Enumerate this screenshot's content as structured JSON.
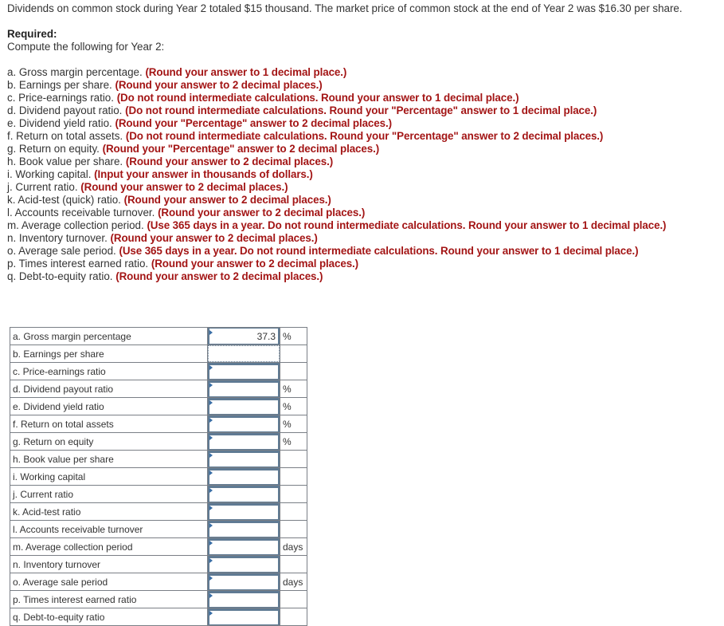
{
  "intro": "Dividends on common stock during Year 2 totaled $15 thousand. The market price of common stock at the end of Year 2 was $16.30 per share.",
  "required": {
    "heading": "Required:",
    "instruction": "Compute the following for Year 2:"
  },
  "questions": [
    {
      "text": "a. Gross margin percentage.",
      "note": "(Round your answer to 1 decimal place.)"
    },
    {
      "text": "b. Earnings per share.",
      "note": "(Round your answer to 2 decimal places.)"
    },
    {
      "text": "c. Price-earnings ratio.",
      "note": "(Do not round intermediate calculations. Round your answer to 1 decimal place.)"
    },
    {
      "text": "d. Dividend payout ratio.",
      "note": "(Do not round intermediate calculations. Round your \"Percentage\" answer to 1 decimal place.)"
    },
    {
      "text": "e. Dividend yield ratio.",
      "note": "(Round your \"Percentage\" answer to 2 decimal places.)"
    },
    {
      "text": "f. Return on total assets.",
      "note": "(Do not round intermediate calculations. Round your \"Percentage\" answer to 2 decimal places.)"
    },
    {
      "text": "g. Return on equity.",
      "note": "(Round your \"Percentage\" answer to 2 decimal places.)"
    },
    {
      "text": "h. Book value per share.",
      "note": "(Round your answer to 2 decimal places.)"
    },
    {
      "text": "i. Working capital.",
      "note": "(Input your answer in thousands of dollars.)"
    },
    {
      "text": "j. Current ratio.",
      "note": "(Round your answer to 2 decimal places.)"
    },
    {
      "text": "k. Acid-test (quick) ratio.",
      "note": "(Round your answer to 2 decimal places.)"
    },
    {
      "text": "l. Accounts receivable turnover.",
      "note": "(Round your answer to 2 decimal places.)"
    },
    {
      "text": "m. Average collection period.",
      "note": "(Use 365 days in a year. Do not round intermediate calculations. Round your answer to 1 decimal place.)"
    },
    {
      "text": "n. Inventory turnover.",
      "note": "(Round your answer to 2 decimal places.)"
    },
    {
      "text": "o. Average sale period.",
      "note": "(Use 365 days in a year. Do not round intermediate calculations. Round your answer to 1 decimal place.)"
    },
    {
      "text": "p. Times interest earned ratio.",
      "note": "(Round your answer to 2 decimal places.)"
    },
    {
      "text": "q. Debt-to-equity ratio.",
      "note": "(Round your answer to 2 decimal places.)"
    }
  ],
  "answer_table": {
    "rows": [
      {
        "label": "a. Gross margin percentage",
        "value": "37.3",
        "unit": "%"
      },
      {
        "label": "b. Earnings per share",
        "value": "",
        "unit": ""
      },
      {
        "label": "c. Price-earnings ratio",
        "value": "",
        "unit": ""
      },
      {
        "label": "d. Dividend payout ratio",
        "value": "",
        "unit": "%"
      },
      {
        "label": "e. Dividend yield ratio",
        "value": "",
        "unit": "%"
      },
      {
        "label": "f. Return on total assets",
        "value": "",
        "unit": "%"
      },
      {
        "label": "g. Return on equity",
        "value": "",
        "unit": "%"
      },
      {
        "label": "h. Book value per share",
        "value": "",
        "unit": ""
      },
      {
        "label": "i. Working capital",
        "value": "",
        "unit": ""
      },
      {
        "label": "j. Current ratio",
        "value": "",
        "unit": ""
      },
      {
        "label": "k. Acid-test ratio",
        "value": "",
        "unit": ""
      },
      {
        "label": "l. Accounts receivable turnover",
        "value": "",
        "unit": ""
      },
      {
        "label": "m. Average collection period",
        "value": "",
        "unit": "days"
      },
      {
        "label": "n. Inventory turnover",
        "value": "",
        "unit": ""
      },
      {
        "label": "o. Average sale period",
        "value": "",
        "unit": "days"
      },
      {
        "label": "p. Times interest earned ratio",
        "value": "",
        "unit": ""
      },
      {
        "label": "q. Debt-to-equity ratio",
        "value": "",
        "unit": ""
      }
    ]
  },
  "colors": {
    "instruction_red": "#a31515",
    "input_border": "#5f7a93",
    "table_border": "#7a7f86"
  }
}
